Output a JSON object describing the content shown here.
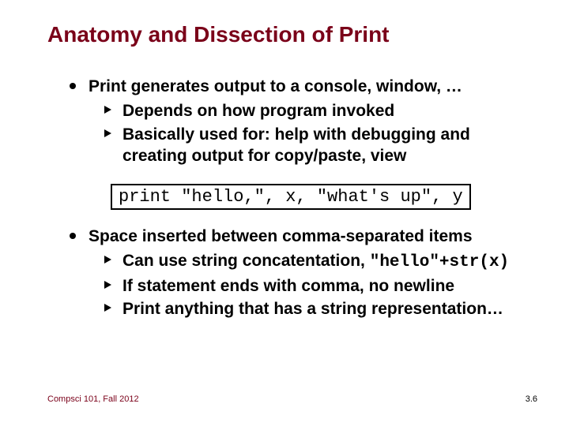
{
  "title": "Anatomy and Dissection of Print",
  "section1": {
    "heading": "Print generates output to  a console, window, …",
    "sub1": "Depends on how program invoked",
    "sub2": "Basically used for: help with debugging and creating output for copy/paste, view"
  },
  "code": "print \"hello,\", x, \"what's up\", y",
  "section2": {
    "heading": "Space inserted between comma-separated items",
    "sub1a": "Can use string concatentation, ",
    "sub1b": "\"hello\"+str(x)",
    "sub2": "If statement ends with comma, no newline",
    "sub3": "Print anything that has a string representation…"
  },
  "footer": {
    "left": "Compsci 101, Fall 2012",
    "right": "3.6"
  }
}
